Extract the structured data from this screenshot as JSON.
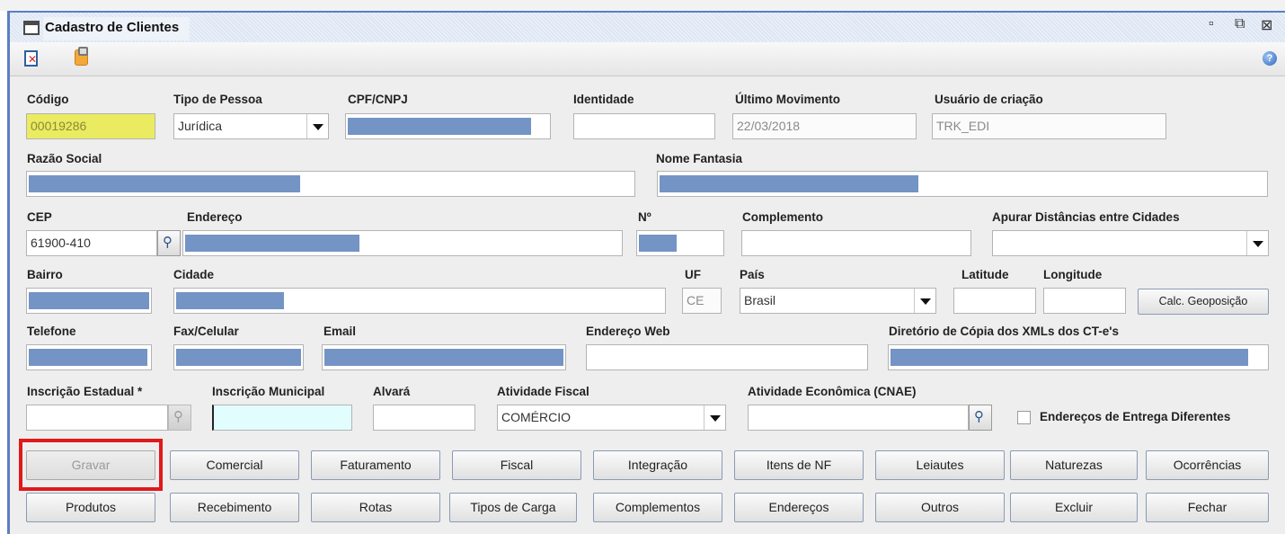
{
  "window": {
    "title": "Cadastro de Clientes",
    "controls": [
      "minimize-icon",
      "maximize-icon",
      "close-icon"
    ]
  },
  "toolbar": {
    "icons": [
      "close-record-icon",
      "clipboard-icon",
      "help-icon"
    ],
    "help_glyph": "?"
  },
  "form": {
    "codigo": {
      "label": "Código",
      "value": "00019286"
    },
    "tipo_pessoa": {
      "label": "Tipo de Pessoa",
      "value": "Jurídica"
    },
    "cpf_cnpj": {
      "label": "CPF/CNPJ",
      "value": ""
    },
    "identidade": {
      "label": "Identidade",
      "value": ""
    },
    "ultimo_movimento": {
      "label": "Último Movimento",
      "value": "22/03/2018"
    },
    "usuario_criacao": {
      "label": "Usuário de criação",
      "value": "TRK_EDI"
    },
    "razao_social": {
      "label": "Razão Social",
      "value": ""
    },
    "nome_fantasia": {
      "label": "Nome Fantasia",
      "value": ""
    },
    "cep": {
      "label": "CEP",
      "value": "61900-410"
    },
    "endereco": {
      "label": "Endereço",
      "value": ""
    },
    "numero": {
      "label": "Nº",
      "value": ""
    },
    "complemento": {
      "label": "Complemento",
      "value": ""
    },
    "apurar_distancias": {
      "label": "Apurar Distâncias entre Cidades",
      "value": ""
    },
    "bairro": {
      "label": "Bairro",
      "value": ""
    },
    "cidade": {
      "label": "Cidade",
      "value": ""
    },
    "uf": {
      "label": "UF",
      "value": "CE"
    },
    "pais": {
      "label": "País",
      "value": "Brasil"
    },
    "latitude": {
      "label": "Latitude",
      "value": ""
    },
    "longitude": {
      "label": "Longitude",
      "value": ""
    },
    "calc_geoposicao": {
      "label": "Calc. Geoposição",
      "mnemonic": "G"
    },
    "telefone": {
      "label": "Telefone",
      "value": ""
    },
    "fax_celular": {
      "label": "Fax/Celular",
      "value": ""
    },
    "email": {
      "label": "Email",
      "value": ""
    },
    "endereco_web": {
      "label": "Endereço Web",
      "value": ""
    },
    "diretorio_xml": {
      "label": "Diretório de Cópia dos XMLs dos CT-e's",
      "value": ""
    },
    "inscricao_estadual": {
      "label": "Inscrição Estadual *",
      "value": ""
    },
    "inscricao_municipal": {
      "label": "Inscrição Municipal",
      "value": ""
    },
    "alvara": {
      "label": "Alvará",
      "value": ""
    },
    "atividade_fiscal": {
      "label": "Atividade Fiscal",
      "value": "COMÉRCIO"
    },
    "atividade_economica": {
      "label": "Atividade Econômica (CNAE)",
      "value": ""
    },
    "enderecos_entrega": {
      "label": "Endereços de Entrega Diferentes",
      "checked": false
    }
  },
  "buttons": {
    "row1": [
      "Gravar",
      "Comercial",
      "Faturamento",
      "Fiscal",
      "Integração",
      "Itens de NF",
      "Leiautes",
      "Naturezas",
      "Ocorrências"
    ],
    "row2": [
      "Produtos",
      "Recebimento",
      "Rotas",
      "Tipos de Carga",
      "Complementos",
      "Endereços",
      "Outros",
      "Excluir",
      "Fechar"
    ],
    "disabled": [
      "Gravar"
    ],
    "highlighted": "Gravar"
  },
  "colors": {
    "window_border": "#5b7fc2",
    "redaction": "#7394c4",
    "required_field": "#eaeb60",
    "focus_field": "#e2fdfd",
    "highlight_box": "#e0191b"
  }
}
